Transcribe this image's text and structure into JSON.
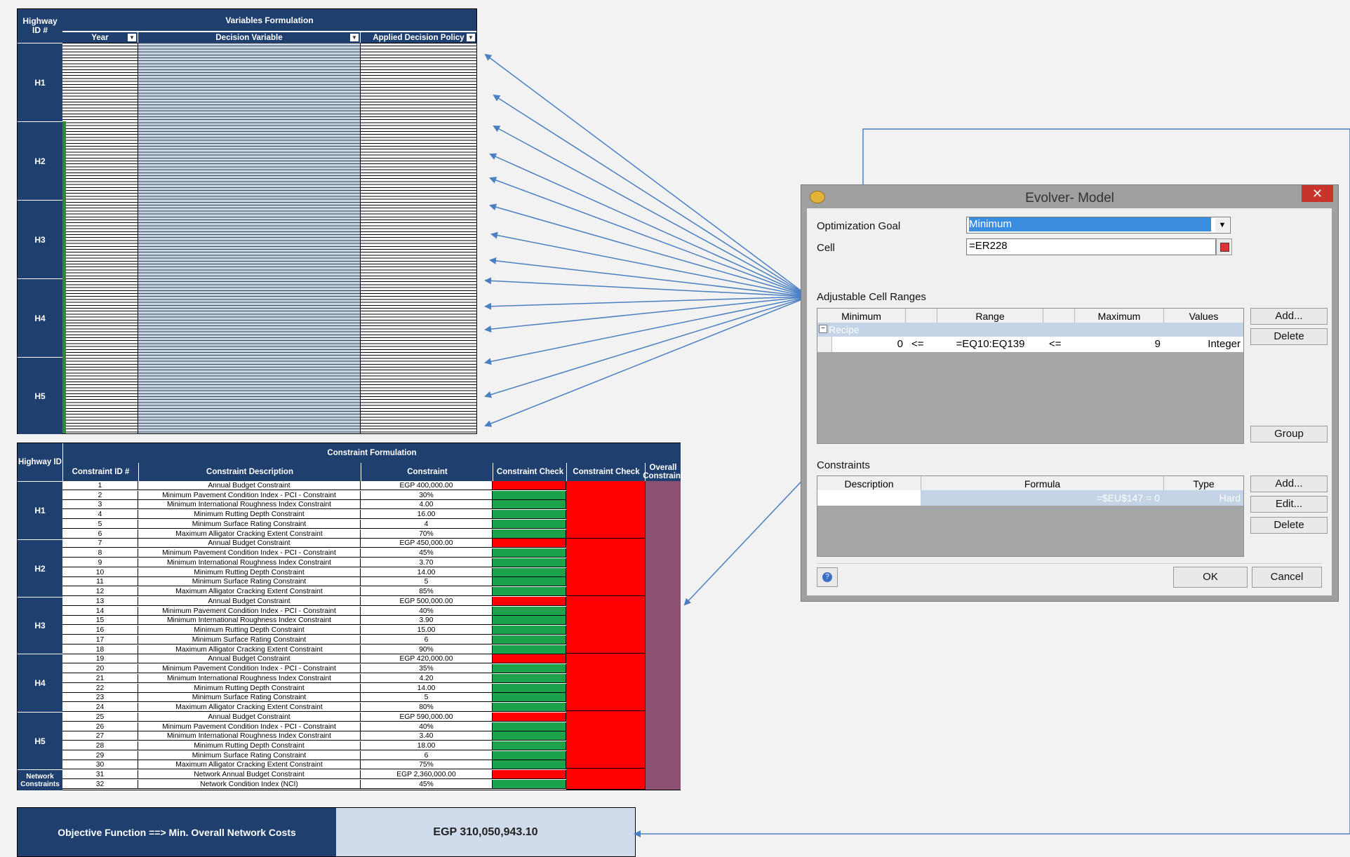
{
  "variables": {
    "highway_header": "Highway ID #",
    "title": "Variables Formulation",
    "col_year": "Year",
    "col_decision": "Decision Variable",
    "col_policy": "Applied Decision Policy",
    "groups": [
      "H1",
      "H2",
      "H3",
      "H4",
      "H5"
    ]
  },
  "constraints": {
    "title": "Constraint Formulation",
    "highway_header": "Highway ID",
    "col_id": "Constraint ID #",
    "col_desc": "Constraint Description",
    "col_constraint": "Constraint",
    "col_check": "Constraint Check",
    "col_check2": "Constraint Check",
    "col_overall": "Overall Constraint",
    "groups": [
      "H1",
      "H2",
      "H3",
      "H4",
      "H5",
      "Network Constraints"
    ],
    "rows": [
      [
        "1",
        "Annual Budget Constraint",
        "EGP 400,000.00"
      ],
      [
        "2",
        "Minimum Pavement Condition Index - PCI - Constraint",
        "30%"
      ],
      [
        "3",
        "Minimum International Roughness Index Constraint",
        "4.00"
      ],
      [
        "4",
        "Minimum Rutting Depth Constraint",
        "16.00"
      ],
      [
        "5",
        "Minimum Surface Rating Constraint",
        "4"
      ],
      [
        "6",
        "Maximum Alligator Cracking Extent Constraint",
        "70%"
      ],
      [
        "7",
        "Annual Budget Constraint",
        "EGP 450,000.00"
      ],
      [
        "8",
        "Minimum Pavement Condition Index - PCI - Constraint",
        "45%"
      ],
      [
        "9",
        "Minimum International Roughness Index Constraint",
        "3.70"
      ],
      [
        "10",
        "Minimum Rutting Depth Constraint",
        "14.00"
      ],
      [
        "11",
        "Minimum Surface Rating Constraint",
        "5"
      ],
      [
        "12",
        "Maximum Alligator Cracking Extent Constraint",
        "85%"
      ],
      [
        "13",
        "Annual Budget Constraint",
        "EGP 500,000.00"
      ],
      [
        "14",
        "Minimum Pavement Condition Index - PCI - Constraint",
        "40%"
      ],
      [
        "15",
        "Minimum International Roughness Index Constraint",
        "3.90"
      ],
      [
        "16",
        "Minimum Rutting Depth Constraint",
        "15.00"
      ],
      [
        "17",
        "Minimum Surface Rating Constraint",
        "6"
      ],
      [
        "18",
        "Maximum Alligator Cracking Extent Constraint",
        "90%"
      ],
      [
        "19",
        "Annual Budget Constraint",
        "EGP 420,000.00"
      ],
      [
        "20",
        "Minimum Pavement Condition Index - PCI - Constraint",
        "35%"
      ],
      [
        "21",
        "Minimum International Roughness Index Constraint",
        "4.20"
      ],
      [
        "22",
        "Minimum Rutting Depth Constraint",
        "14.00"
      ],
      [
        "23",
        "Minimum Surface Rating Constraint",
        "5"
      ],
      [
        "24",
        "Maximum Alligator Cracking Extent Constraint",
        "80%"
      ],
      [
        "25",
        "Annual Budget Constraint",
        "EGP 590,000.00"
      ],
      [
        "26",
        "Minimum Pavement Condition Index - PCI - Constraint",
        "40%"
      ],
      [
        "27",
        "Minimum International Roughness Index Constraint",
        "3.40"
      ],
      [
        "28",
        "Minimum Rutting Depth Constraint",
        "18.00"
      ],
      [
        "29",
        "Minimum Surface Rating Constraint",
        "6"
      ],
      [
        "30",
        "Maximum Alligator Cracking Extent Constraint",
        "75%"
      ],
      [
        "31",
        "Network Annual Budget Constraint",
        "EGP 2,360,000.00"
      ],
      [
        "32",
        "Network Condition Index (NCI)",
        "45%"
      ]
    ],
    "check_status": [
      "red",
      "green",
      "green",
      "green",
      "green",
      "green",
      "red",
      "green",
      "green",
      "green",
      "green",
      "green",
      "red",
      "green",
      "green",
      "green",
      "green",
      "green",
      "red",
      "green",
      "green",
      "green",
      "green",
      "green",
      "red",
      "green",
      "green",
      "green",
      "green",
      "green",
      "red",
      "green"
    ]
  },
  "objective": {
    "label": "Objective Function ==> Min. Overall Network Costs",
    "value": "EGP 310,050,943.10"
  },
  "dialog": {
    "title": "Evolver- Model",
    "close": "✕",
    "goal_label": "Optimization Goal",
    "goal_value": "Minimum",
    "cell_label": "Cell",
    "cell_value": "=ER228",
    "adjustable_label": "Adjustable Cell Ranges",
    "adj_headers": [
      "Minimum",
      "",
      "Range",
      "",
      "Maximum",
      "Values"
    ],
    "recipe_label": "Recipe",
    "recipe_row": {
      "min": "0",
      "op1": "<=",
      "range": "=EQ10:EQ139",
      "op2": "<=",
      "max": "9",
      "values": "Integer"
    },
    "constraints_label": "Constraints",
    "con_headers": [
      "Description",
      "Formula",
      "Type"
    ],
    "con_row": {
      "desc": "",
      "formula": "=$EU$147 =  0",
      "type": "Hard"
    },
    "btn_add1": "Add...",
    "btn_delete1": "Delete",
    "btn_group": "Group",
    "btn_add2": "Add...",
    "btn_edit": "Edit...",
    "btn_delete2": "Delete",
    "btn_ok": "OK",
    "btn_cancel": "Cancel"
  },
  "colors": {
    "navy": "#1f3f6e",
    "red": "#ff0000",
    "green": "#1aa34a",
    "overall": "#8b5072",
    "arrow": "#4a7fc1"
  }
}
